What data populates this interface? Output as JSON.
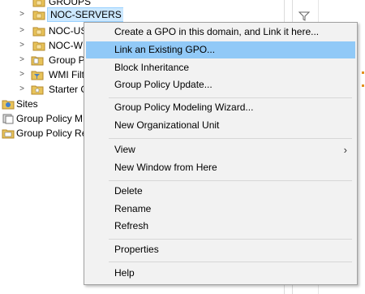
{
  "tree": {
    "items": [
      {
        "label": "GROUPS",
        "expander": "",
        "icon": "ou-folder-icon"
      },
      {
        "label": "NOC-SERVERS",
        "expander": ">",
        "icon": "ou-folder-icon"
      },
      {
        "label": "NOC-US",
        "expander": ">",
        "icon": "ou-folder-icon"
      },
      {
        "label": "NOC-W",
        "expander": ">",
        "icon": "ou-folder-icon"
      },
      {
        "label": "Group Po",
        "expander": ">",
        "icon": "gpo-folder-icon"
      },
      {
        "label": "WMI Filt",
        "expander": ">",
        "icon": "wmi-folder-icon"
      },
      {
        "label": "Starter G",
        "expander": ">",
        "icon": "starter-gpo-folder-icon"
      },
      {
        "label": "Sites",
        "expander": "",
        "icon": "sites-icon"
      },
      {
        "label": "Group Policy M",
        "expander": "",
        "icon": "gp-modeling-icon"
      },
      {
        "label": "Group Policy Re",
        "expander": "",
        "icon": "gp-results-icon"
      }
    ]
  },
  "context_menu": {
    "items": [
      {
        "label": "Create a GPO in this domain, and Link it here..."
      },
      {
        "label": "Link an Existing GPO..."
      },
      {
        "label": "Block Inheritance"
      },
      {
        "label": "Group Policy Update..."
      },
      {
        "label": "Group Policy Modeling Wizard..."
      },
      {
        "label": "New Organizational Unit"
      },
      {
        "label": "View",
        "submenu_arrow": "›"
      },
      {
        "label": "New Window from Here"
      },
      {
        "label": "Delete"
      },
      {
        "label": "Rename"
      },
      {
        "label": "Refresh"
      },
      {
        "label": "Properties"
      },
      {
        "label": "Help"
      }
    ],
    "highlighted": "Link an Existing GPO..."
  },
  "colors": {
    "menu_highlight": "#91c9f7",
    "selection": "#cce8ff",
    "folder": "#e8c35a"
  }
}
